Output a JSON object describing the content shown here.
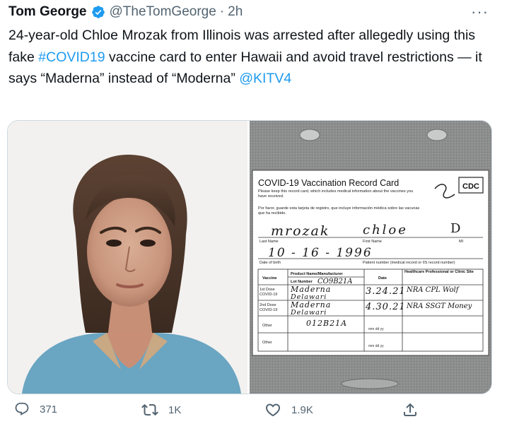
{
  "tweet": {
    "author_name": "Tom George",
    "handle": "@TheTomGeorge",
    "separator": "·",
    "time": "2h",
    "more": "···",
    "text_parts": {
      "a": "24-year-old Chloe Mrozak from Illinois was arrested after allegedly using this fake ",
      "hashtag": "#COVID19",
      "b": " vaccine card to enter Hawaii and avoid travel restrictions — it says “Maderna” instead of “Moderna” ",
      "mention": "@KITV4"
    }
  },
  "card": {
    "title": "COVID-19 Vaccination Record Card",
    "logo": "CDC",
    "note_en": "Please keep this record card, which includes medical information about the vaccines you have received.",
    "note_es": "Por favor, guarde esta tarjeta de registro, que incluye información médica sobre las vacunas que ha recibido.",
    "last_name_label": "Last Name",
    "first_name_label": "First Name",
    "mi_label": "MI",
    "dob_label": "Date of birth",
    "patient_label": "Patient number (medical record or IIS record number)",
    "hw_last": "mrozak",
    "hw_first": "chloe",
    "hw_mi": "D",
    "hw_dob": "10 - 16 - 1996",
    "col_vaccine": "Vaccine",
    "col_product": "Product Name/Manufacturer",
    "col_lot": "Lot Number",
    "col_date": "Date",
    "col_site": "Healthcare Professional or Clinic Site",
    "row1": "1st Dose COVID-19",
    "row2": "2nd Dose COVID-19",
    "row3": "Other",
    "row4": "Other",
    "date_hint": "mm   dd   yy",
    "hw_lot_header": "CO9B21A",
    "hw_r1_product": "Maderna",
    "hw_r1_lot": "Delawari",
    "hw_r1_date": "3.24.21",
    "hw_r1_site": "NRA CPL Wolf",
    "hw_r2_product": "Maderna",
    "hw_r2_lot": "Delawari",
    "hw_r2_date": "4.30.21",
    "hw_r2_site": "NRA SSGT Money",
    "hw_r3_lot": "012B21A"
  },
  "actions": {
    "reply_count": "371",
    "retweet_count": "1K",
    "like_count": "1.9K"
  },
  "colors": {
    "link": "#1d9bf0",
    "muted": "#536471",
    "verified": "#1d9bf0"
  }
}
